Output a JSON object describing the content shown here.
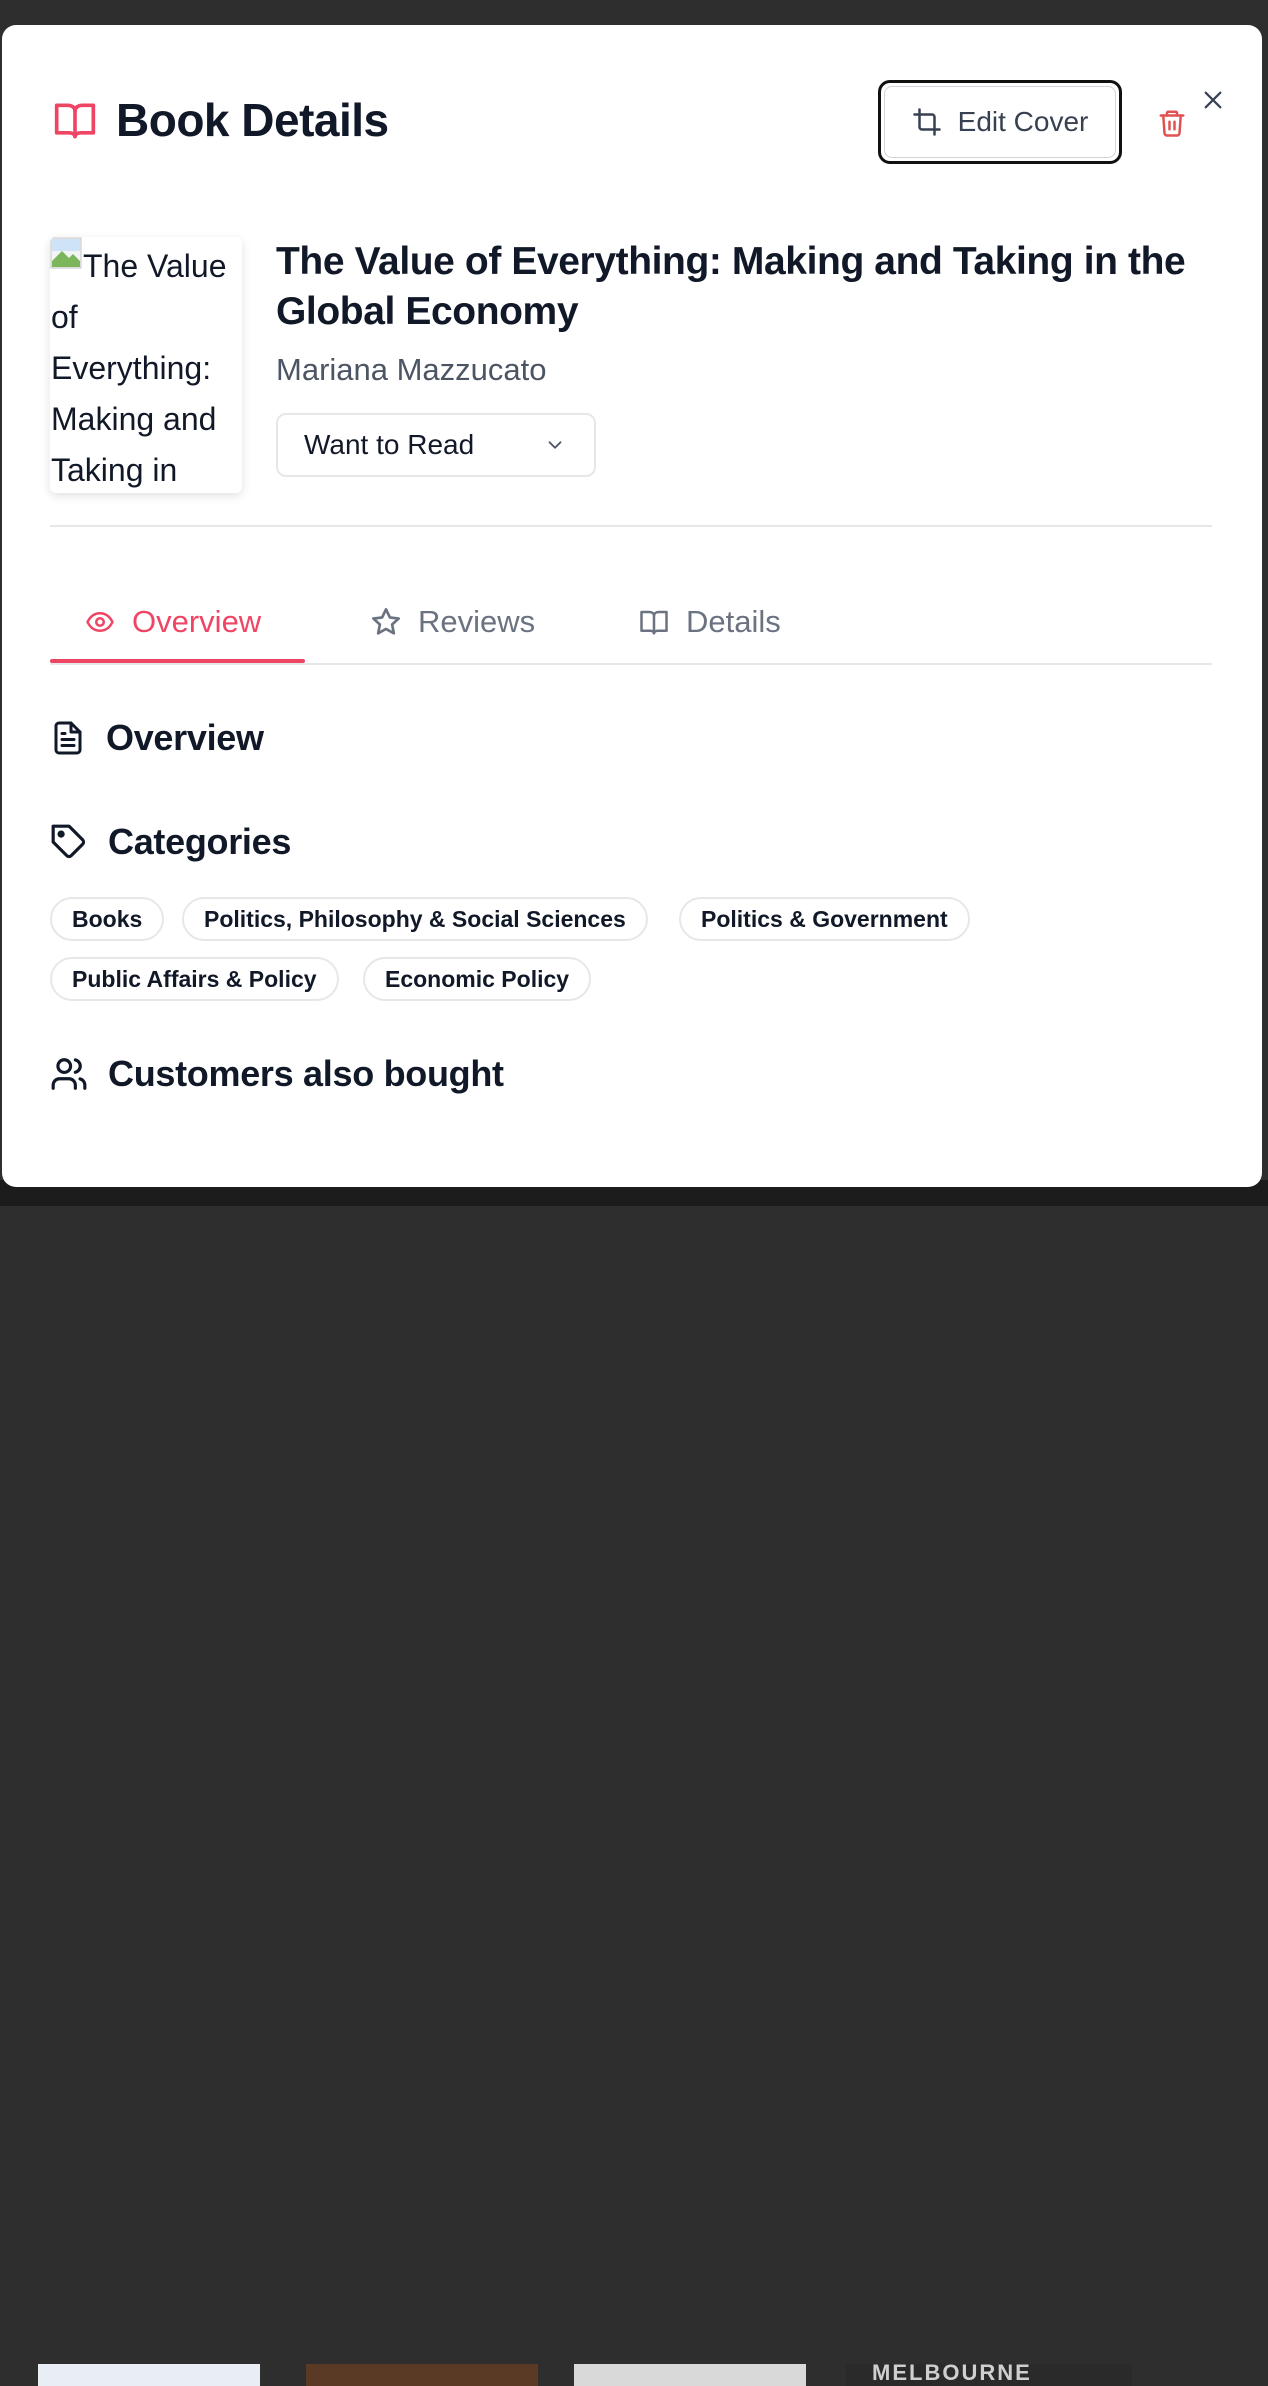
{
  "modal": {
    "title": "Book Details",
    "edit_cover_label": "Edit Cover"
  },
  "book": {
    "cover_alt": "The Value of Everything: Making and Taking in",
    "title": "The Value of Everything: Making and Taking in the Global Economy",
    "author": "Mariana Mazzucato",
    "status": "Want to Read"
  },
  "tabs": [
    {
      "label": "Overview",
      "icon": "eye-icon",
      "active": true
    },
    {
      "label": "Reviews",
      "icon": "star-icon",
      "active": false
    },
    {
      "label": "Details",
      "icon": "book-open-icon",
      "active": false
    }
  ],
  "sections": {
    "overview": "Overview",
    "categories": "Categories",
    "customers_also_bought": "Customers also bought"
  },
  "categories": [
    "Books",
    "Politics, Philosophy & Social Sciences",
    "Politics & Government",
    "Public Affairs & Policy",
    "Economic Policy"
  ],
  "background_text": "MELBOURNE",
  "colors": {
    "accent": "#ef4565",
    "danger": "#e05252",
    "text": "#111827",
    "muted": "#6b7280"
  }
}
